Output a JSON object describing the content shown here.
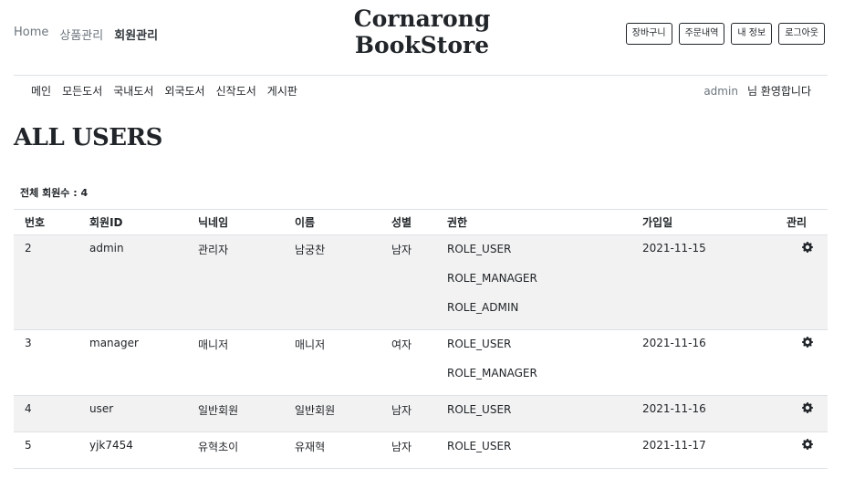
{
  "topnav": {
    "home": "Home",
    "products": "상품관리",
    "members": "회원관리"
  },
  "logo": {
    "line1": "Cornarong",
    "line2": "BookStore"
  },
  "header_buttons": {
    "cart": "장바구니",
    "orders": "주문내역",
    "myinfo": "내 정보",
    "logout": "로그아웃"
  },
  "subnav": {
    "main": "메인",
    "all_books": "모든도서",
    "domestic": "국내도서",
    "foreign": "외국도서",
    "new": "신작도서",
    "board": "게시판"
  },
  "welcome": {
    "username": "admin",
    "message": "님 환영합니다"
  },
  "page_title": "ALL USERS",
  "member_count": "전체 회원수 : 4",
  "table": {
    "headers": [
      "번호",
      "회원ID",
      "닉네임",
      "이름",
      "성별",
      "권한",
      "가입일",
      "관리"
    ],
    "rows": [
      {
        "num": "2",
        "id": "admin",
        "nickname": "관리자",
        "name": "남궁찬",
        "gender": "남자",
        "roles": [
          "ROLE_USER",
          "ROLE_MANAGER",
          "ROLE_ADMIN"
        ],
        "date": "2021-11-15"
      },
      {
        "num": "3",
        "id": "manager",
        "nickname": "매니저",
        "name": "매니저",
        "gender": "여자",
        "roles": [
          "ROLE_USER",
          "ROLE_MANAGER"
        ],
        "date": "2021-11-16"
      },
      {
        "num": "4",
        "id": "user",
        "nickname": "일반회원",
        "name": "일반회원",
        "gender": "남자",
        "roles": [
          "ROLE_USER"
        ],
        "date": "2021-11-16"
      },
      {
        "num": "5",
        "id": "yjk7454",
        "nickname": "유혁초이",
        "name": "유재혁",
        "gender": "남자",
        "roles": [
          "ROLE_USER"
        ],
        "date": "2021-11-17"
      }
    ]
  },
  "icons": {
    "manage": "gear-icon"
  }
}
